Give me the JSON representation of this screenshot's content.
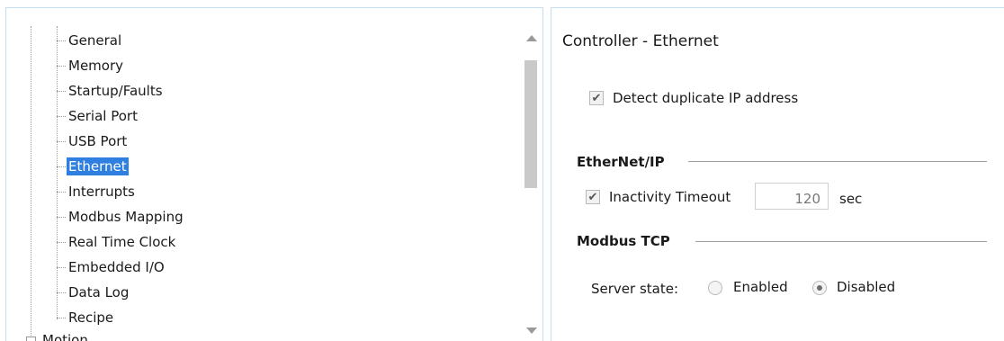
{
  "tree": {
    "items": [
      {
        "label": "General"
      },
      {
        "label": "Memory"
      },
      {
        "label": "Startup/Faults"
      },
      {
        "label": "Serial Port"
      },
      {
        "label": "USB Port"
      },
      {
        "label": "Ethernet",
        "selected": true
      },
      {
        "label": "Interrupts"
      },
      {
        "label": "Modbus Mapping"
      },
      {
        "label": "Real Time Clock"
      },
      {
        "label": "Embedded I/O"
      },
      {
        "label": "Data Log"
      },
      {
        "label": "Recipe"
      }
    ],
    "partial_item": "Motion",
    "selection_color": "#2f7fe0"
  },
  "settings": {
    "title": "Controller - Ethernet",
    "detect_duplicate_ip": {
      "label": "Detect duplicate IP address",
      "checked": true
    },
    "ethernet_ip": {
      "section_title": "EtherNet/IP",
      "inactivity_timeout": {
        "label": "Inactivity Timeout",
        "checked": true,
        "value": "120",
        "unit": "sec"
      }
    },
    "modbus_tcp": {
      "section_title": "Modbus TCP",
      "server_state_label": "Server state:",
      "options": [
        {
          "label": "Enabled",
          "checked": false
        },
        {
          "label": "Disabled",
          "checked": true
        }
      ]
    }
  }
}
